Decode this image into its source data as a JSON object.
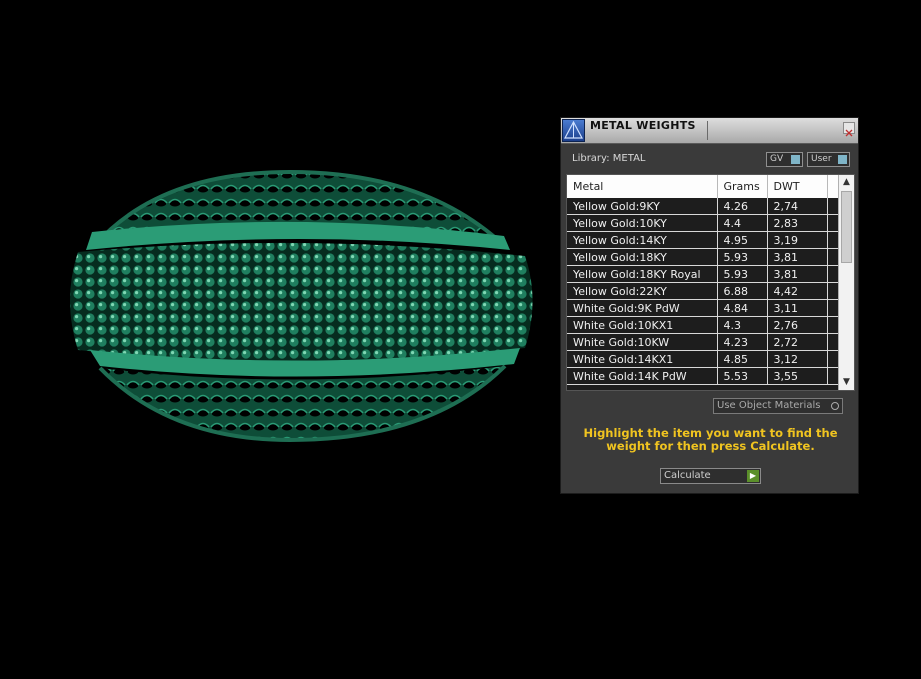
{
  "panel": {
    "title": "METAL WEIGHTS",
    "library_label": "Library: METAL",
    "gv_label": "GV",
    "user_label": "User",
    "table": {
      "headers": [
        "Metal",
        "Grams",
        "DWT"
      ],
      "rows": [
        [
          "Yellow Gold:9KY",
          "4.26",
          "2,74"
        ],
        [
          "Yellow Gold:10KY",
          "4.4",
          "2,83"
        ],
        [
          "Yellow Gold:14KY",
          "4.95",
          "3,19"
        ],
        [
          "Yellow Gold:18KY",
          "5.93",
          "3,81"
        ],
        [
          "Yellow Gold:18KY Royal",
          "5.93",
          "3,81"
        ],
        [
          "Yellow Gold:22KY",
          "6.88",
          "4,42"
        ],
        [
          "White Gold:9K PdW",
          "4.84",
          "3,11"
        ],
        [
          "White Gold:10KX1",
          "4.3",
          "2,76"
        ],
        [
          "White Gold:10KW",
          "4.23",
          "2,72"
        ],
        [
          "White Gold:14KX1",
          "4.85",
          "3,12"
        ],
        [
          "White Gold:14K PdW",
          "5.53",
          "3,55"
        ]
      ]
    },
    "use_object_label": "Use Object Materials",
    "hint": "Highlight the item you want to find the weight for then press Calculate.",
    "calculate_label": "Calculate"
  },
  "colors": {
    "model": "#1f7f5f",
    "hint": "#f0c420"
  },
  "icons": {
    "app_logo": "pyramid-logo-icon",
    "close": "close-icon",
    "scroll_up": "chevron-up-icon",
    "scroll_down": "chevron-down-icon",
    "calculate": "play-arrow-icon"
  }
}
